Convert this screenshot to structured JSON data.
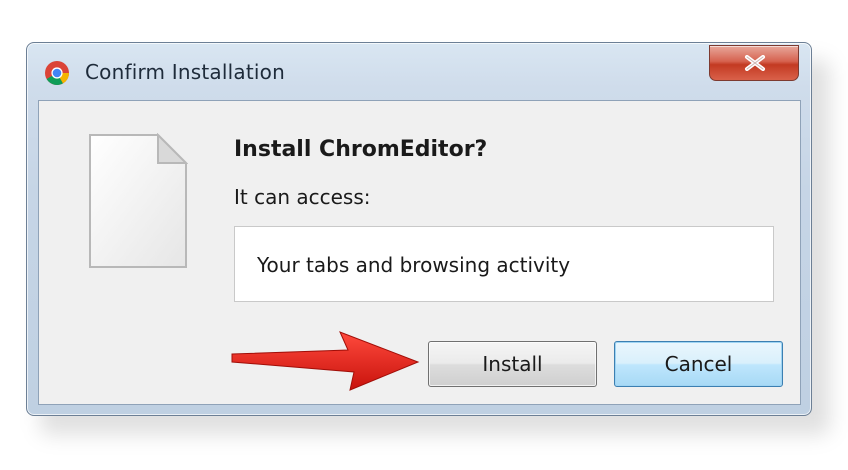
{
  "window": {
    "title": "Confirm Installation",
    "close_symbol": "X"
  },
  "dialog": {
    "heading": "Install ChromEditor?",
    "access_label": "It can access:",
    "permissions": [
      "Your tabs and browsing activity"
    ]
  },
  "buttons": {
    "install_label": "Install",
    "cancel_label": "Cancel"
  },
  "icons": {
    "app": "chrome-icon",
    "extension": "document-icon",
    "pointer": "red-arrow"
  },
  "colors": {
    "arrow": "#e8231b",
    "close_button": "#c33a22",
    "default_button_border": "#3c7fb1"
  }
}
